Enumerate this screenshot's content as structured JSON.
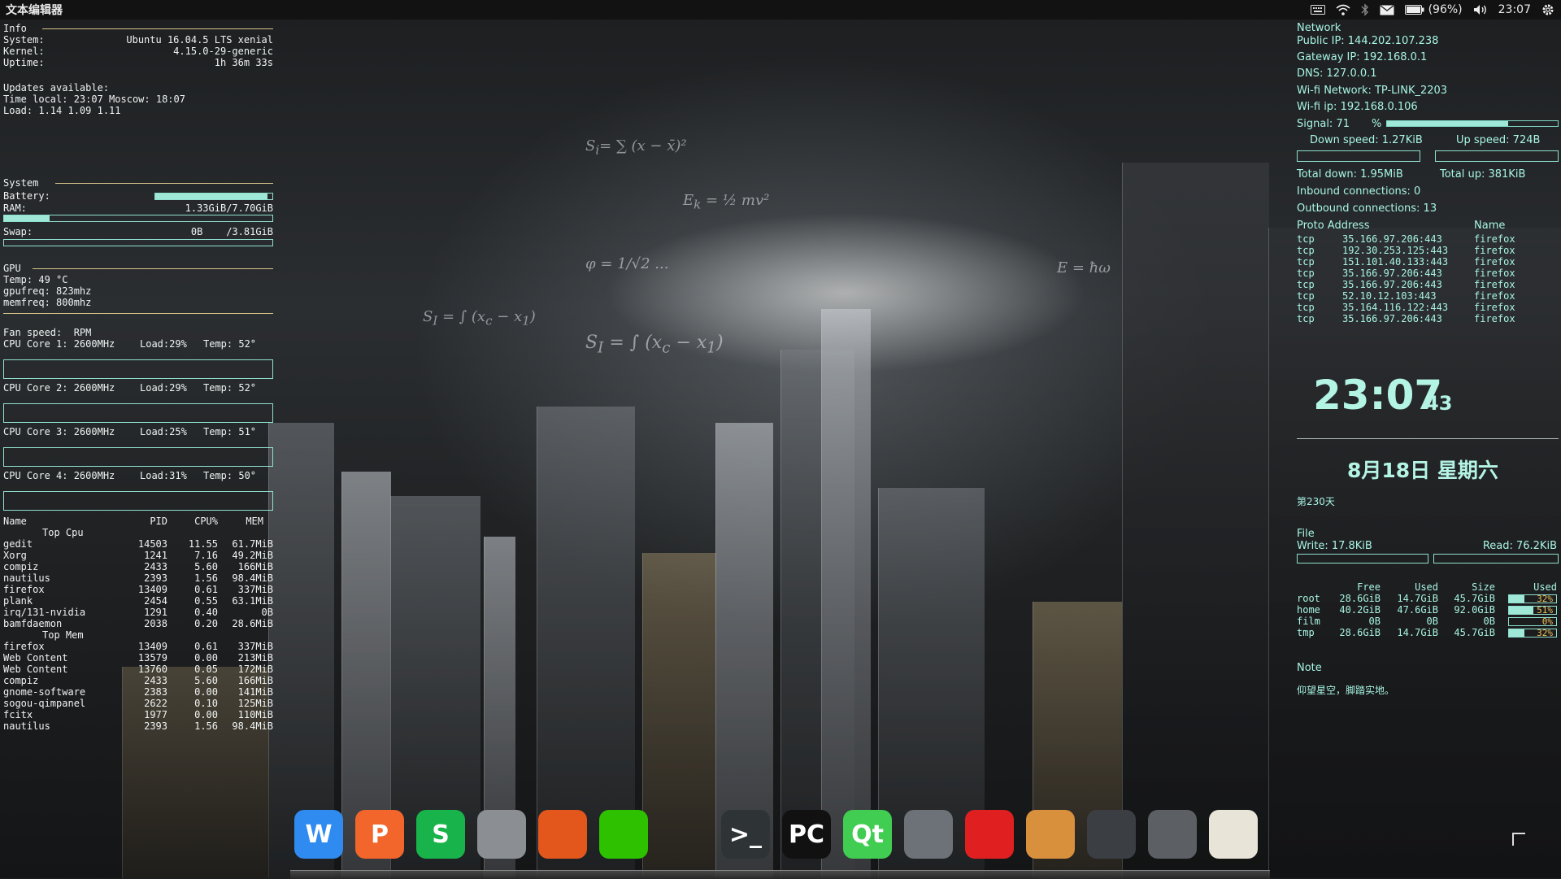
{
  "top_panel": {
    "app_title": "文本编辑器",
    "battery_label": "(96%)",
    "clock": "23:07",
    "tray_icons": [
      "keyboard-icon",
      "wifi-icon",
      "bluetooth-icon",
      "mail-icon",
      "battery-icon",
      "volume-icon",
      "settings-gear-icon"
    ]
  },
  "info": {
    "title": "Info",
    "system_label": "System:",
    "system_value": "Ubuntu 16.04.5 LTS xenial",
    "kernel_label": "Kernel:",
    "kernel_value": "4.15.0-29-generic",
    "uptime_label": "Uptime:",
    "uptime_value": "1h 36m 33s",
    "updates": "Updates available:",
    "time_line": "Time local: 23:07 Moscow: 18:07",
    "load_line": "Load: 1.14 1.09 1.11"
  },
  "system": {
    "title": "System",
    "battery_label": "Battery:",
    "battery_level": 0.96,
    "ram_label": "RAM:",
    "ram_value": "1.33GiB/7.70GiB",
    "ram_level": 0.17,
    "swap_label": "Swap:",
    "swap_value": "0B    /3.81GiB",
    "swap_level": 0
  },
  "gpu": {
    "title": "GPU",
    "temp": "Temp: 49 °C",
    "gpufreq": "gpufreq: 823mhz",
    "memfreq": "memfreq: 800mhz"
  },
  "cpu": {
    "fan": "Fan speed:  RPM",
    "cores": [
      {
        "label": "CPU Core 1: 2600MHz",
        "load": "Load:29%",
        "temp": "Temp: 52°"
      },
      {
        "label": "CPU Core 2: 2600MHz",
        "load": "Load:29%",
        "temp": "Temp: 52°"
      },
      {
        "label": "CPU Core 3: 2600MHz",
        "load": "Load:25%",
        "temp": "Temp: 51°"
      },
      {
        "label": "CPU Core 4: 2600MHz",
        "load": "Load:31%",
        "temp": "Temp: 50°"
      }
    ]
  },
  "processes": {
    "headers": [
      "Name",
      "PID",
      "CPU%",
      "MEM"
    ],
    "top_cpu_title": "Top Cpu",
    "top_cpu": [
      [
        "gedit",
        "14503",
        "11.55",
        "61.7MiB"
      ],
      [
        "Xorg",
        "1241",
        "7.16",
        "49.2MiB"
      ],
      [
        "compiz",
        "2433",
        "5.60",
        "166MiB"
      ],
      [
        "nautilus",
        "2393",
        "1.56",
        "98.4MiB"
      ],
      [
        "firefox",
        "13409",
        "0.61",
        "337MiB"
      ],
      [
        "plank",
        "2454",
        "0.55",
        "63.1MiB"
      ],
      [
        "irq/131-nvidia",
        "1291",
        "0.40",
        "0B"
      ],
      [
        "bamfdaemon",
        "2038",
        "0.20",
        "28.6MiB"
      ]
    ],
    "top_mem_title": "Top Mem",
    "top_mem": [
      [
        "firefox",
        "13409",
        "0.61",
        "337MiB"
      ],
      [
        "Web Content",
        "13579",
        "0.00",
        "213MiB"
      ],
      [
        "Web Content",
        "13760",
        "0.05",
        "172MiB"
      ],
      [
        "compiz",
        "2433",
        "5.60",
        "166MiB"
      ],
      [
        "gnome-software",
        "2383",
        "0.00",
        "141MiB"
      ],
      [
        "sogou-qimpanel",
        "2622",
        "0.10",
        "125MiB"
      ],
      [
        "fcitx",
        "1977",
        "0.00",
        "110MiB"
      ],
      [
        "nautilus",
        "2393",
        "1.56",
        "98.4MiB"
      ]
    ]
  },
  "network": {
    "title": "Network",
    "public_ip": "Public IP: 144.202.107.238",
    "gateway_ip": "Gateway IP: 192.168.0.1",
    "dns": "DNS: 127.0.0.1",
    "wifi_network": "Wi-fi Network: TP-LINK_2203",
    "wifi_ip": "Wi-fi ip: 192.168.0.106",
    "signal": "Signal: 71",
    "signal_unit": "%",
    "signal_level": 0.71,
    "down_speed": "Down speed: 1.27KiB",
    "up_speed": "Up speed: 724B",
    "total_down": "Total down: 1.95MiB",
    "total_up": "Total up: 381KiB",
    "inbound": "Inbound connections: 0",
    "outbound": "Outbound connections: 13",
    "conn_header_left": "Proto Address",
    "conn_header_right": "Name",
    "connections": [
      [
        "tcp",
        "35.166.97.206:443",
        "firefox"
      ],
      [
        "tcp",
        "192.30.253.125:443",
        "firefox"
      ],
      [
        "tcp",
        "151.101.40.133:443",
        "firefox"
      ],
      [
        "tcp",
        "35.166.97.206:443",
        "firefox"
      ],
      [
        "tcp",
        "35.166.97.206:443",
        "firefox"
      ],
      [
        "tcp",
        "52.10.12.103:443",
        "firefox"
      ],
      [
        "tcp",
        "35.164.116.122:443",
        "firefox"
      ],
      [
        "tcp",
        "35.166.97.206:443",
        "firefox"
      ]
    ]
  },
  "clock": {
    "time": "23:07",
    "seconds": "43",
    "date": "8月18日 星期六",
    "day_of_year": "第230天"
  },
  "file": {
    "title": "File",
    "write": "Write: 17.8KiB",
    "read": "Read: 76.2KiB",
    "headers": [
      "Free",
      "Used",
      "Size",
      "Used"
    ],
    "rows": [
      {
        "name": "root",
        "free": "28.6GiB",
        "used": "14.7GiB",
        "size": "45.7GiB",
        "pct": "32%",
        "level": 0.32
      },
      {
        "name": "home",
        "free": "40.2GiB",
        "used": "47.6GiB",
        "size": "92.0GiB",
        "pct": "51%",
        "level": 0.51
      },
      {
        "name": "film",
        "free": "0B",
        "used": "0B",
        "size": "0B",
        "pct": "0%",
        "level": 0
      },
      {
        "name": "tmp",
        "free": "28.6GiB",
        "used": "14.7GiB",
        "size": "45.7GiB",
        "pct": "32%",
        "level": 0.32
      }
    ]
  },
  "note": {
    "title": "Note",
    "text": "仰望星空，脚踏实地。"
  },
  "dock": {
    "items": [
      {
        "name": "wps-writer-icon",
        "glyph": "W",
        "color": "#2f8bef"
      },
      {
        "name": "wps-presentation-icon",
        "glyph": "P",
        "color": "#f2652b"
      },
      {
        "name": "wps-spreadsheet-icon",
        "glyph": "S",
        "color": "#18b34a"
      },
      {
        "name": "file-manager-icon",
        "glyph": "",
        "color": "#8b8f94"
      },
      {
        "name": "firefox-icon",
        "glyph": "",
        "color": "#e3571d"
      },
      {
        "name": "wechat-icon",
        "glyph": "",
        "color": "#2dc100"
      },
      {
        "name": "qq-icon",
        "glyph": "",
        "color": "#1b1b1b"
      },
      {
        "name": "terminal-icon",
        "glyph": ">_",
        "color": "#2e3436"
      },
      {
        "name": "pycharm-icon",
        "glyph": "PC",
        "color": "#111111"
      },
      {
        "name": "qt-creator-icon",
        "glyph": "Qt",
        "color": "#41cd52"
      },
      {
        "name": "system-tools-icon",
        "glyph": "",
        "color": "#6d7278"
      },
      {
        "name": "netease-music-icon",
        "glyph": "",
        "color": "#e02020"
      },
      {
        "name": "home-folder-icon",
        "glyph": "",
        "color": "#d9903d"
      },
      {
        "name": "lock-screen-icon",
        "glyph": "",
        "color": "#3b3f44"
      },
      {
        "name": "trash-icon",
        "glyph": "",
        "color": "#5c6064"
      },
      {
        "name": "text-editor-icon",
        "glyph": "",
        "color": "#e8e4d8"
      }
    ]
  }
}
